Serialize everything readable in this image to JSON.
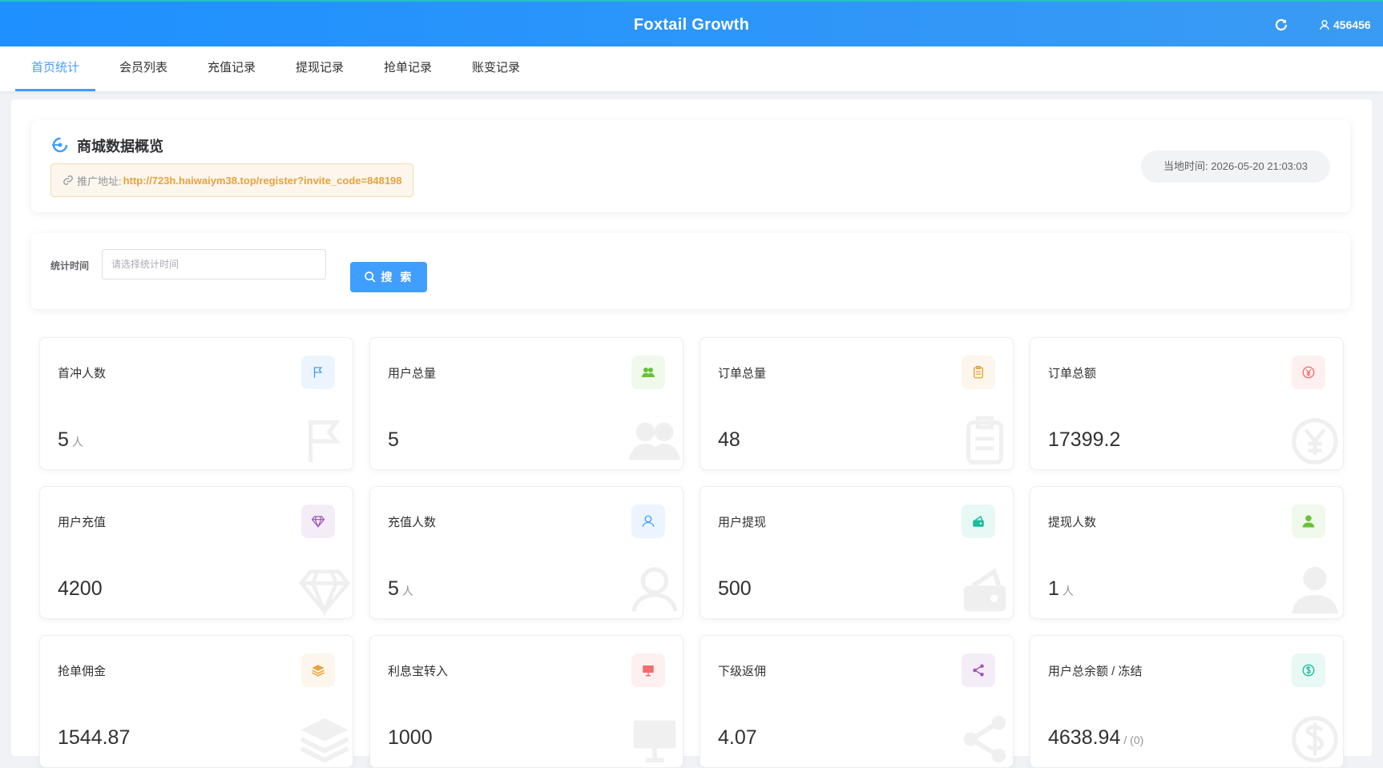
{
  "header": {
    "title": "Foxtail Growth",
    "user": "456456",
    "refresh_icon": "refresh-icon",
    "user_icon": "user-icon"
  },
  "tabs": [
    {
      "label": "首页统计",
      "active": true
    },
    {
      "label": "会员列表"
    },
    {
      "label": "充值记录"
    },
    {
      "label": "提现记录"
    },
    {
      "label": "抢单记录"
    },
    {
      "label": "账变记录"
    }
  ],
  "overview": {
    "heading": "商城数据概览",
    "promo_label": "推广地址:",
    "promo_url": "http://723h.haiwaiym38.top/register?invite_code=848198",
    "clock_label": "当地时间:",
    "clock_value": "2026-05-20 21:03:03"
  },
  "filter": {
    "label": "统计时间",
    "placeholder": "请选择统计时间",
    "search_label": "搜 索"
  },
  "stats": [
    {
      "label": "首冲人数",
      "value": "5",
      "unit": "人",
      "icon": "flag-icon",
      "color": "#409eff",
      "bg": "#ecf5ff"
    },
    {
      "label": "用户总量",
      "value": "5",
      "unit": "",
      "icon": "users-icon",
      "color": "#67c23a",
      "bg": "#f0f9eb"
    },
    {
      "label": "订单总量",
      "value": "48",
      "unit": "",
      "icon": "clipboard-icon",
      "color": "#e6a23c",
      "bg": "#fdf6ec"
    },
    {
      "label": "订单总额",
      "value": "17399.2",
      "unit": "",
      "icon": "yen-icon",
      "color": "#f56c6c",
      "bg": "#fef0f0"
    },
    {
      "label": "用户充值",
      "value": "4200",
      "unit": "",
      "icon": "diamond-icon",
      "color": "#9b59b6",
      "bg": "#f4ecf7"
    },
    {
      "label": "充值人数",
      "value": "5",
      "unit": "人",
      "icon": "user-outline-icon",
      "color": "#409eff",
      "bg": "#ecf5ff"
    },
    {
      "label": "用户提现",
      "value": "500",
      "unit": "",
      "icon": "wallet-icon",
      "color": "#1abc9c",
      "bg": "#e8f8f5"
    },
    {
      "label": "提现人数",
      "value": "1",
      "unit": "人",
      "icon": "person-icon",
      "color": "#67c23a",
      "bg": "#f0f9eb"
    },
    {
      "label": "抢单佣金",
      "value": "1544.87",
      "unit": "",
      "icon": "layers-icon",
      "color": "#e6a23c",
      "bg": "#fdf6ec"
    },
    {
      "label": "利息宝转入",
      "value": "1000",
      "unit": "",
      "icon": "board-icon",
      "color": "#f56c6c",
      "bg": "#fef0f0"
    },
    {
      "label": "下级返佣",
      "value": "4.07",
      "unit": "",
      "icon": "share-icon",
      "color": "#9b59b6",
      "bg": "#f4ecf7"
    },
    {
      "label": "用户总余额 / 冻结",
      "value": "4638.94",
      "unit": "/ (0)",
      "icon": "dollar-icon",
      "color": "#1abc9c",
      "bg": "#e8f8f5"
    }
  ]
}
